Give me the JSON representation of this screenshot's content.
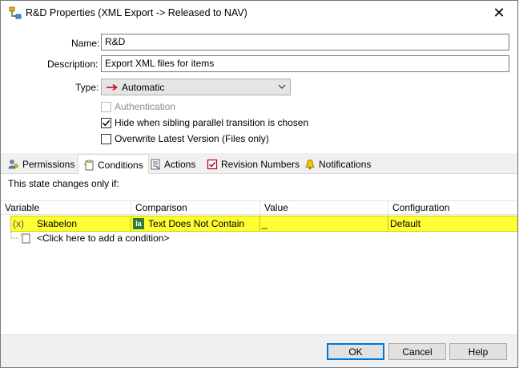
{
  "window": {
    "title": "R&D Properties (XML Export -> Released to NAV)",
    "close_glyph": "✕",
    "icon": "workflow-transition-icon"
  },
  "form": {
    "name_label": "Name:",
    "name_value": "R&D",
    "description_label": "Description:",
    "description_value": "Export XML files for items",
    "type_label": "Type:",
    "type_value": "Automatic",
    "type_icon": "red-arrow-right-icon",
    "authentication_label": "Authentication",
    "authentication_checked": false,
    "authentication_enabled": false,
    "hide_sibling_label": "Hide when sibling parallel transition is chosen",
    "hide_sibling_checked": true,
    "overwrite_label": "Overwrite Latest Version (Files only)",
    "overwrite_checked": false
  },
  "tabs": [
    {
      "label": "Permissions",
      "icon": "permissions-icon",
      "active": false
    },
    {
      "label": "Conditions",
      "icon": "conditions-icon",
      "active": true
    },
    {
      "label": "Actions",
      "icon": "actions-icon",
      "active": false
    },
    {
      "label": "Revision Numbers",
      "icon": "revision-numbers-icon",
      "active": false
    },
    {
      "label": "Notifications",
      "icon": "bell-icon",
      "active": false
    }
  ],
  "conditions": {
    "intro": "This state changes only if:",
    "columns": [
      "Variable",
      "Comparison",
      "Value",
      "Configuration"
    ],
    "rows": [
      {
        "variable_prefix": "(x)",
        "variable": "Skabelon",
        "comparison_icon": "la",
        "comparison": "Text Does Not Contain",
        "value": "_",
        "configuration": "Default",
        "selected": true
      }
    ],
    "add_row_label": "<Click here to add a condition>",
    "selection_color": "#ffff33"
  },
  "buttons": {
    "ok": "OK",
    "cancel": "Cancel",
    "help": "Help"
  },
  "colors": {
    "accent": "#0078d7",
    "arrow_red": "#d0021b"
  }
}
